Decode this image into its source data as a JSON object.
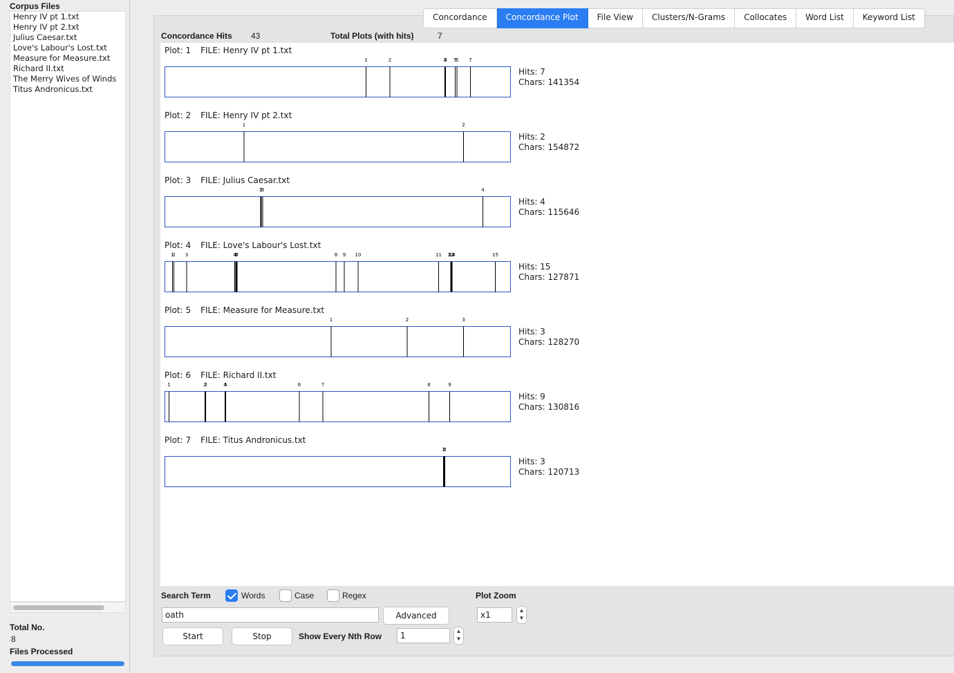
{
  "sidebar": {
    "title": "Corpus Files",
    "files": [
      "Henry IV pt 1.txt",
      "Henry IV pt 2.txt",
      "Julius Caesar.txt",
      "Love's Labour's Lost.txt",
      "Measure for Measure.txt",
      "Richard II.txt",
      "The Merry Wives of Winds",
      "Titus Andronicus.txt"
    ],
    "total_label": "Total No.",
    "total_value": "8",
    "processed_label": "Files Processed",
    "progress": 1.0
  },
  "tabs": [
    {
      "label": "Concordance",
      "active": false
    },
    {
      "label": "Concordance Plot",
      "active": true
    },
    {
      "label": "File View",
      "active": false
    },
    {
      "label": "Clusters/N-Grams",
      "active": false
    },
    {
      "label": "Collocates",
      "active": false
    },
    {
      "label": "Word List",
      "active": false
    },
    {
      "label": "Keyword List",
      "active": false
    }
  ],
  "summary": {
    "hits_label": "Concordance Hits",
    "hits_value": "43",
    "plots_label": "Total Plots (with hits)",
    "plots_value": "7"
  },
  "plots": [
    {
      "plot_label": "Plot: 1",
      "file_label": "FILE: Henry IV pt 1.txt",
      "hits": "Hits: 7",
      "chars": "Chars: 141354",
      "marks": [
        {
          "n": "1",
          "pos": 0.582
        },
        {
          "n": "2",
          "pos": 0.651
        },
        {
          "n": "3",
          "pos": 0.81
        },
        {
          "n": "4",
          "pos": 0.812
        },
        {
          "n": "5",
          "pos": 0.84
        },
        {
          "n": "6",
          "pos": 0.845
        },
        {
          "n": "7",
          "pos": 0.884
        }
      ]
    },
    {
      "plot_label": "Plot: 2",
      "file_label": "FILE: Henry IV pt 2.txt",
      "hits": "Hits: 2",
      "chars": "Chars: 154872",
      "marks": [
        {
          "n": "1",
          "pos": 0.229
        },
        {
          "n": "2",
          "pos": 0.864
        }
      ]
    },
    {
      "plot_label": "Plot: 3",
      "file_label": "FILE: Julius Caesar.txt",
      "hits": "Hits: 4",
      "chars": "Chars: 115646",
      "marks": [
        {
          "n": "1",
          "pos": 0.277
        },
        {
          "n": "2",
          "pos": 0.279
        },
        {
          "n": "3",
          "pos": 0.283
        },
        {
          "n": "4",
          "pos": 0.92
        }
      ]
    },
    {
      "plot_label": "Plot: 4",
      "file_label": "FILE: Love's Labour's Lost.txt",
      "hits": "Hits: 15",
      "chars": "Chars: 127871",
      "marks": [
        {
          "n": "1",
          "pos": 0.022
        },
        {
          "n": "2",
          "pos": 0.026
        },
        {
          "n": "3",
          "pos": 0.063
        },
        {
          "n": "4",
          "pos": 0.202
        },
        {
          "n": "5",
          "pos": 0.205
        },
        {
          "n": "6",
          "pos": 0.207
        },
        {
          "n": "7",
          "pos": 0.209
        },
        {
          "n": "8",
          "pos": 0.495
        },
        {
          "n": "9",
          "pos": 0.519
        },
        {
          "n": "10",
          "pos": 0.559
        },
        {
          "n": "11",
          "pos": 0.792
        },
        {
          "n": "12",
          "pos": 0.827
        },
        {
          "n": "13",
          "pos": 0.829
        },
        {
          "n": "14",
          "pos": 0.831
        },
        {
          "n": "15",
          "pos": 0.956
        }
      ]
    },
    {
      "plot_label": "Plot: 5",
      "file_label": "FILE: Measure for Measure.txt",
      "hits": "Hits: 3",
      "chars": "Chars: 128270",
      "marks": [
        {
          "n": "1",
          "pos": 0.481
        },
        {
          "n": "2",
          "pos": 0.701
        },
        {
          "n": "3",
          "pos": 0.864
        }
      ]
    },
    {
      "plot_label": "Plot: 6",
      "file_label": "FILE: Richard II.txt",
      "hits": "Hits: 9",
      "chars": "Chars: 130816",
      "marks": [
        {
          "n": "1",
          "pos": 0.012
        },
        {
          "n": "2",
          "pos": 0.116
        },
        {
          "n": "3",
          "pos": 0.118
        },
        {
          "n": "4",
          "pos": 0.174
        },
        {
          "n": "5",
          "pos": 0.176
        },
        {
          "n": "6",
          "pos": 0.389
        },
        {
          "n": "7",
          "pos": 0.457
        },
        {
          "n": "8",
          "pos": 0.764
        },
        {
          "n": "9",
          "pos": 0.824
        }
      ]
    },
    {
      "plot_label": "Plot: 7",
      "file_label": "FILE: Titus Andronicus.txt",
      "hits": "Hits: 3",
      "chars": "Chars: 120713",
      "marks": [
        {
          "n": "1",
          "pos": 0.806
        },
        {
          "n": "2",
          "pos": 0.808
        },
        {
          "n": "3",
          "pos": 0.81
        }
      ]
    }
  ],
  "controls": {
    "search_term_label": "Search Term",
    "words_label": "Words",
    "words_checked": true,
    "case_label": "Case",
    "case_checked": false,
    "regex_label": "Regex",
    "regex_checked": false,
    "search_value": "oath",
    "advanced_label": "Advanced",
    "start_label": "Start",
    "stop_label": "Stop",
    "nth_row_label": "Show Every Nth Row",
    "nth_row_value": "1",
    "zoom_label": "Plot Zoom",
    "zoom_value": "x1"
  },
  "colors": {
    "accent": "#2a7df2",
    "plot_border": "#2b55c8",
    "hit_line": "#000000"
  }
}
